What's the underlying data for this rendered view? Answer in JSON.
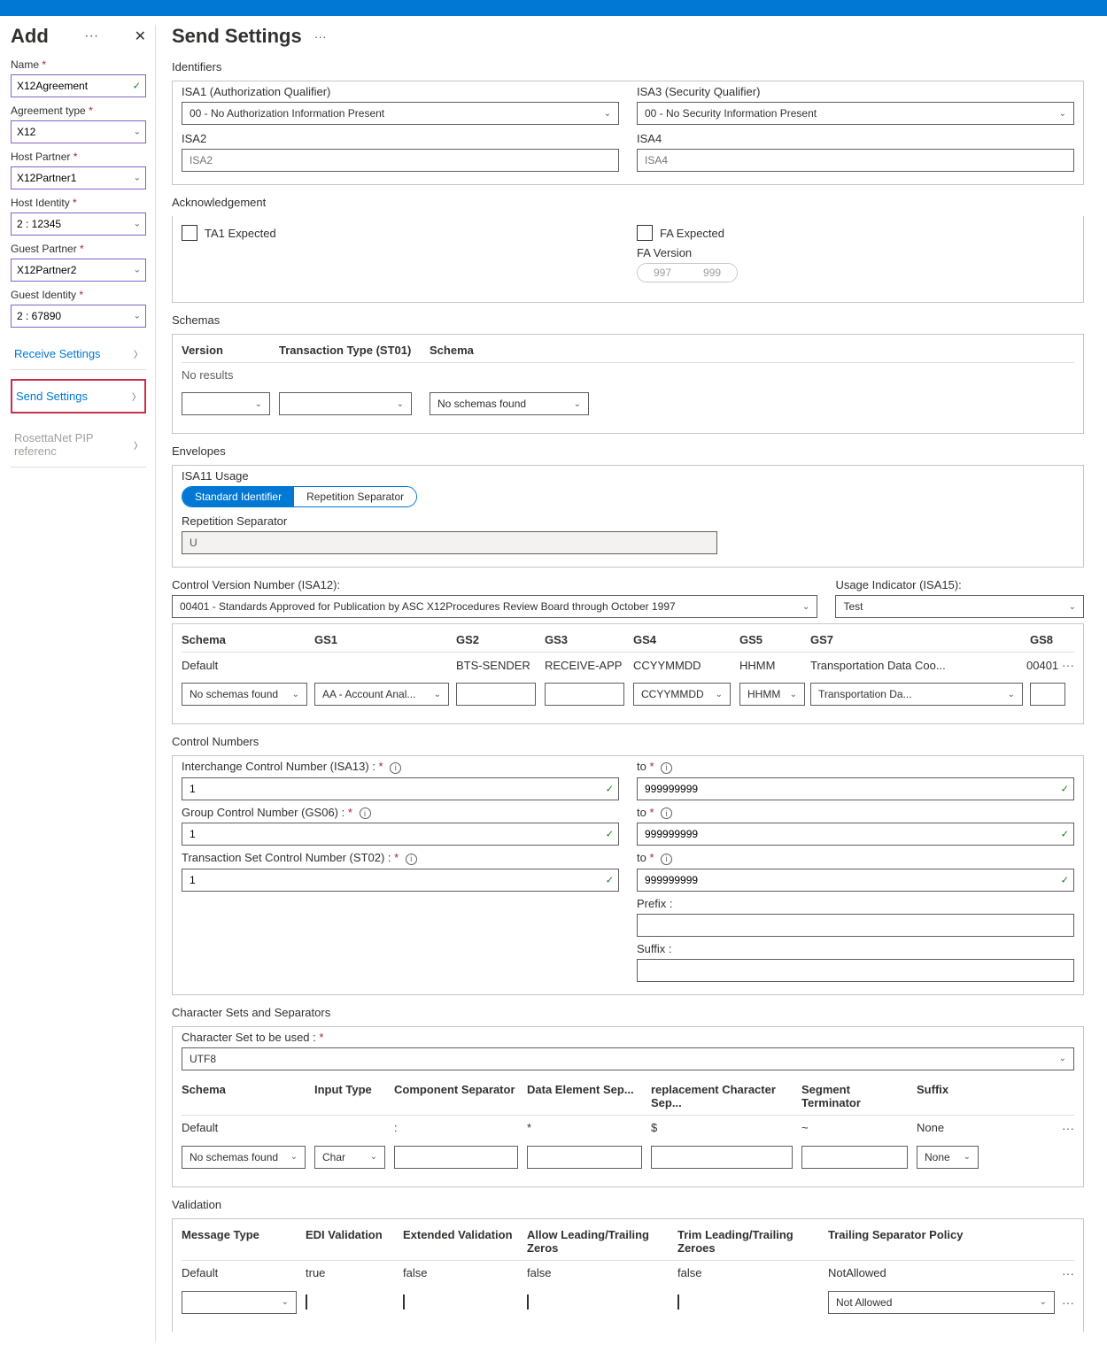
{
  "sidebar": {
    "title": "Add",
    "name_label": "Name",
    "name_value": "X12Agreement",
    "agreement_type_label": "Agreement type",
    "agreement_type_value": "X12",
    "host_partner_label": "Host Partner",
    "host_partner_value": "X12Partner1",
    "host_identity_label": "Host Identity",
    "host_identity_value": "2 : 12345",
    "guest_partner_label": "Guest Partner",
    "guest_partner_value": "X12Partner2",
    "guest_identity_label": "Guest Identity",
    "guest_identity_value": "2 : 67890",
    "links": [
      "Receive Settings",
      "Send Settings",
      "RosettaNet PIP referenc"
    ]
  },
  "main": {
    "title": "Send Settings"
  },
  "identifiers": {
    "title": "Identifiers",
    "isa1_label": "ISA1 (Authorization Qualifier)",
    "isa1_value": "00 - No Authorization Information Present",
    "isa3_label": "ISA3 (Security Qualifier)",
    "isa3_value": "00 - No Security Information Present",
    "isa2_label": "ISA2",
    "isa2_ph": "ISA2",
    "isa4_label": "ISA4",
    "isa4_ph": "ISA4"
  },
  "ack": {
    "title": "Acknowledgement",
    "ta1": "TA1 Expected",
    "fa": "FA Expected",
    "fa_version_label": "FA Version",
    "v997": "997",
    "v999": "999"
  },
  "schemas": {
    "title": "Schemas",
    "cols": [
      "Version",
      "Transaction Type (ST01)",
      "Schema"
    ],
    "no_results": "No results",
    "no_schemas": "No schemas found"
  },
  "envelopes": {
    "title": "Envelopes",
    "isa11_label": "ISA11 Usage",
    "standard": "Standard Identifier",
    "repetition": "Repetition Separator",
    "rep_sep_label": "Repetition Separator",
    "rep_sep_value": "U",
    "isa12_label": "Control Version Number (ISA12):",
    "isa12_value": "00401 - Standards Approved for Publication by ASC X12Procedures Review Board through October 1997",
    "isa15_label": "Usage Indicator (ISA15):",
    "isa15_value": "Test",
    "grid": {
      "cols": [
        "Schema",
        "GS1",
        "GS2",
        "GS3",
        "GS4",
        "GS5",
        "GS7",
        "GS8"
      ],
      "row": [
        "Default",
        "",
        "BTS-SENDER",
        "RECEIVE-APP",
        "CCYYMMDD",
        "HHMM",
        "Transportation Data Coo...",
        "00401"
      ],
      "inputs": {
        "schema": "No schemas found",
        "gs1": "AA - Account Anal...",
        "gs4": "CCYYMMDD",
        "gs5": "HHMM",
        "gs7": "Transportation Da..."
      }
    }
  },
  "ctrl": {
    "title": "Control Numbers",
    "isa13_label": "Interchange Control Number (ISA13) :",
    "gs06_label": "Group Control Number (GS06) :",
    "st02_label": "Transaction Set Control Number (ST02) :",
    "to_label": "to",
    "from_val": "1",
    "to_val": "999999999",
    "prefix_label": "Prefix :",
    "suffix_label": "Suffix :"
  },
  "charset": {
    "title": "Character Sets and Separators",
    "used_label": "Character Set to be used :",
    "used_value": "UTF8",
    "cols": [
      "Schema",
      "Input Type",
      "Component Separator",
      "Data Element Sep...",
      "replacement Character Sep...",
      "Segment Terminator",
      "Suffix"
    ],
    "row": [
      "Default",
      "",
      ":",
      "*",
      "$",
      "~",
      "None"
    ],
    "inputs": {
      "schema": "No schemas found",
      "input_type": "Char",
      "suffix": "None"
    }
  },
  "validation": {
    "title": "Validation",
    "cols": [
      "Message Type",
      "EDI Validation",
      "Extended Validation",
      "Allow Leading/Trailing Zeros",
      "Trim Leading/Trailing Zeroes",
      "Trailing Separator Policy"
    ],
    "row": [
      "Default",
      "true",
      "false",
      "false",
      "false",
      "NotAllowed"
    ],
    "policy_input": "Not Allowed"
  }
}
